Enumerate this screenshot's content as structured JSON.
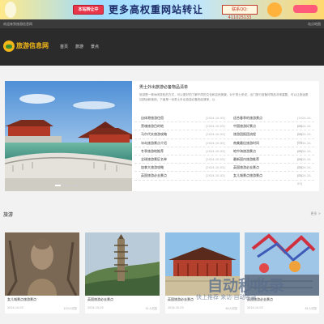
{
  "banner": {
    "badge": "本站转让中",
    "slogan": "更多高权重网站转让",
    "contact": "联系QQ: 411025133"
  },
  "topbar": {
    "left": "欢迎来到旅游信息网",
    "right": "站点地图"
  },
  "nav": {
    "logo_text": "旅游信息网",
    "menu": [
      "首页",
      "旅游",
      "景点"
    ]
  },
  "feature": {
    "title": "男士外出旅游必备物品清单",
    "description": "旅游是一种休闲放松的方式，可以更好的了解不同的文化和自然美景。对于男士来说，出门旅行准备好物品非常重要，可以让旅途更加舒适和愉快。下面是一份男士外出旅游必备物品清单，以",
    "articles": [
      {
        "left": "自体港旅游住宿",
        "left_date": "[2024-10-03]",
        "right": "适合春季的旅游景点",
        "right_date": "[2024-10-03]"
      },
      {
        "left": "黑魂旅游目的地",
        "left_date": "[2024-10-03]",
        "right": "中国旅游好景点",
        "right_date": "[2024-10-03]"
      },
      {
        "left": "马尔代夫旅游攻略",
        "left_date": "[2024-10-03]",
        "right": "旅游团报团流程",
        "right_date": "[2024-10-03]"
      },
      {
        "left": "冰岛旅游景点介绍",
        "left_date": "[2024-10-03]",
        "right": "南美最佳旅游时间",
        "right_date": "[2024-10-03]"
      },
      {
        "left": "冬季旅游地推荐",
        "left_date": "[2024-10-03]",
        "right": "地中海旅游景点",
        "right_date": "[2024-10-03]"
      },
      {
        "left": "全球旅游景区名单",
        "left_date": "[2024-10-03]",
        "right": "最新国内旅游推荐",
        "right_date": "[2024-10-03]"
      },
      {
        "left": "加拿大旅游攻略",
        "left_date": "[2024-10-03]",
        "right": "英国旅游必去景点",
        "right_date": "[2024-10-03]"
      },
      {
        "left": "英国旅游必去景点",
        "left_date": "[2024-10-03]",
        "right": "女儿城景点旅游景点",
        "right_date": "[2024-10-03]"
      }
    ]
  },
  "section": {
    "title": "旅游",
    "more": "更多 >"
  },
  "cards": [
    {
      "caption": "女儿城景点旅游景点",
      "date": "2024-10-03",
      "views": "153人浏览"
    },
    {
      "caption": "英国旅游必去景点",
      "date": "2024-10-03",
      "views": "91人浏览"
    },
    {
      "caption": "英国旅游必去景点",
      "date": "2024-10-03",
      "views": "60人浏览"
    },
    {
      "caption": "英国旅游必去景点",
      "date": "2024-10-03",
      "views": "61人浏览"
    }
  ],
  "watermark": {
    "main": "自动秒收录",
    "sub": "快上推荐·来访·自动收录"
  },
  "colors": {
    "accent": "#f2b619",
    "nav_bg": "#2b2b2b",
    "topbar_bg": "#3a3a3a"
  }
}
